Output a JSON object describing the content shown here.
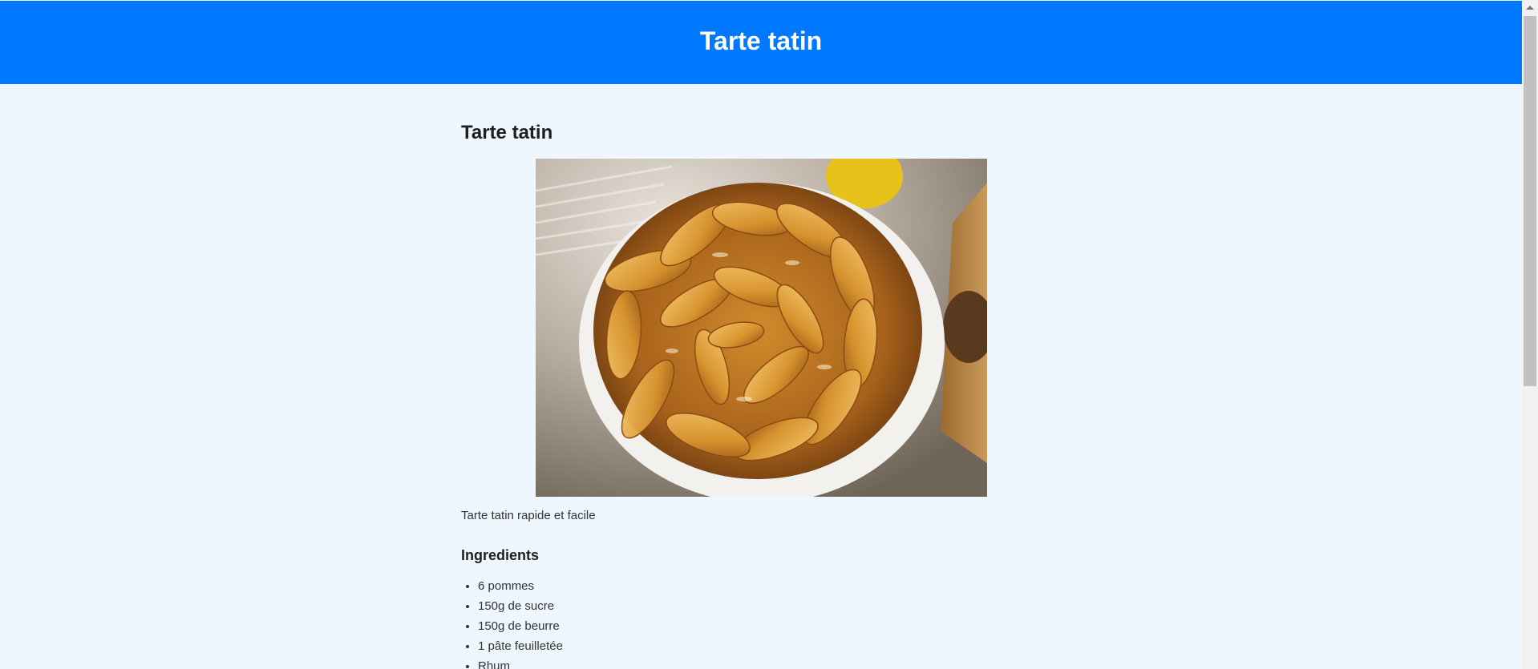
{
  "header": {
    "title": "Tarte tatin"
  },
  "recipe": {
    "title": "Tarte tatin",
    "image_alt": "Tarte tatin",
    "description": "Tarte tatin rapide et facile",
    "ingredients_title": "Ingredients",
    "ingredients": [
      "6 pommes",
      "150g de sucre",
      "150g de beurre",
      "1 pâte feuilletée",
      "Rhum"
    ]
  },
  "colors": {
    "header_bg": "#0078ff",
    "page_bg": "#eef6fe"
  }
}
